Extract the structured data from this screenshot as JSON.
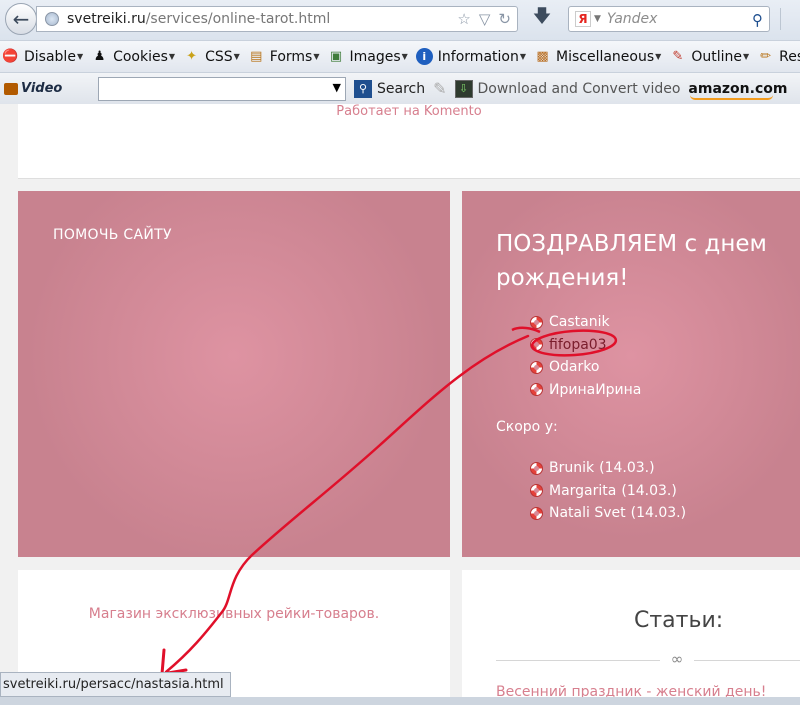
{
  "browser": {
    "url_domain": "svetreiki.ru",
    "url_path": "/services/online-tarot.html",
    "search_placeholder": "Yandex",
    "search_engine_logo": "Я",
    "webdev_toolbar": [
      {
        "label": "Disable",
        "icon": "disable-icon"
      },
      {
        "label": "Cookies",
        "icon": "cookies-icon"
      },
      {
        "label": "CSS",
        "icon": "css-icon"
      },
      {
        "label": "Forms",
        "icon": "forms-icon"
      },
      {
        "label": "Images",
        "icon": "images-icon"
      },
      {
        "label": "Information",
        "icon": "information-icon"
      },
      {
        "label": "Miscellaneous",
        "icon": "miscellaneous-icon"
      },
      {
        "label": "Outline",
        "icon": "outline-icon"
      },
      {
        "label": "Res",
        "icon": "resize-icon"
      }
    ],
    "video_toolbar": {
      "logo": "Video",
      "search_label": "Search",
      "download_label": "Download and Convert video",
      "amazon_label": "amazon.com"
    },
    "status_url": "svetreiki.ru/persacc/nastasia.html"
  },
  "page": {
    "komento": "Работает на Komento",
    "help_widget": {
      "title": "ПОМОЧЬ САЙТУ"
    },
    "birthday_widget": {
      "title": "ПОЗДРАВЛЯЕМ с днем рождения!",
      "today": [
        "Castanik",
        "fifopa03",
        "Odarko",
        "ИринаИрина"
      ],
      "soon_label": "Скоро у:",
      "soon": [
        {
          "name": "Brunik",
          "date": "(14.03.)"
        },
        {
          "name": "Margarita",
          "date": "(14.03.)"
        },
        {
          "name": "Natali Svet",
          "date": "(14.03.)"
        }
      ]
    },
    "shop_link": "Магазин эксклюзивных рейки-товаров.",
    "articles": {
      "title": "Статьи:",
      "first_article": "Весенний праздник - женский день!"
    }
  },
  "colors": {
    "widget_pink": "#d48b98",
    "link_pink": "#d77f8e",
    "annotation_red": "#e0102a"
  }
}
